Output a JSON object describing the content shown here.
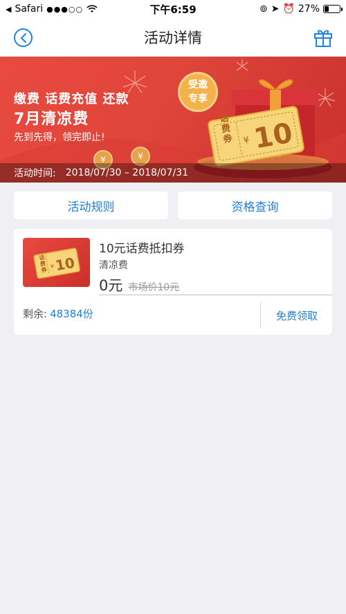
{
  "status_bar": {
    "back_app": "Safari",
    "time": "下午6:59",
    "battery": "27%",
    "battery_level": 0.27
  },
  "nav": {
    "title": "活动详情",
    "back_icon": "chevron-left-circle-icon",
    "right_icon": "gift-icon"
  },
  "banner": {
    "line1": "缴费 话费充值 还款",
    "line2": "7月清凉费",
    "line3": "先到先得，领完即止!",
    "badge_line1": "受邀",
    "badge_line2": "专享",
    "ticket_label": "话费券",
    "ticket_currency": "¥",
    "ticket_value": "10",
    "coin_text": "¥",
    "time_label": "活动时间:",
    "time_value": "2018/07/30 – 2018/07/31"
  },
  "buttons": {
    "rules": "活动规则",
    "qualification": "资格查询"
  },
  "coupon": {
    "thumb_label": "话费券",
    "thumb_currency": "¥",
    "thumb_value": "10",
    "title": "10元话费抵扣券",
    "subtitle": "清凉费",
    "price": "0元",
    "market_price": "市场价10元",
    "remaining_label": "剩余:",
    "remaining_value": "48384份",
    "claim": "免费领取"
  },
  "colors": {
    "accent": "#1f7fd6",
    "banner_red": "#e0453a",
    "background": "#efeff4"
  }
}
